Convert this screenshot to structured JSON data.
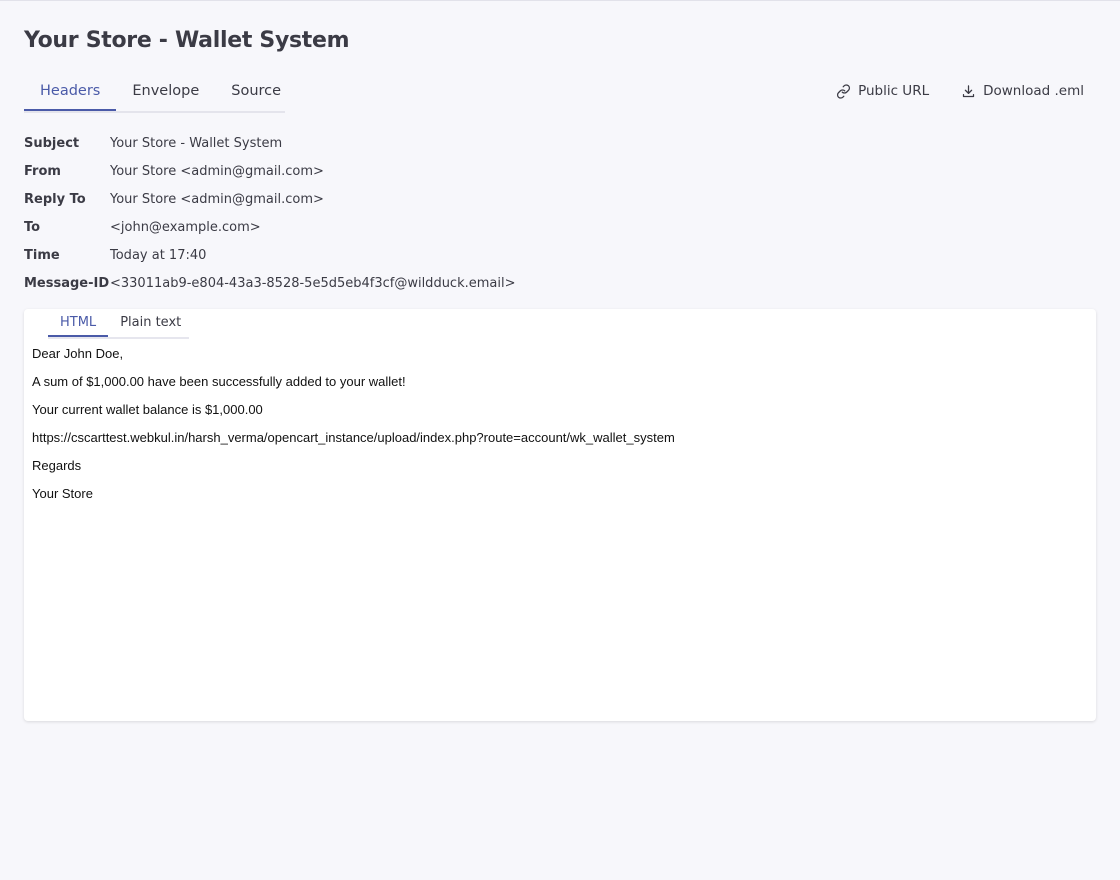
{
  "page_title": "Your Store - Wallet System",
  "tabs": [
    {
      "label": "Headers",
      "active": true
    },
    {
      "label": "Envelope",
      "active": false
    },
    {
      "label": "Source",
      "active": false
    }
  ],
  "actions": {
    "public_url": {
      "label": "Public URL",
      "icon": "link-icon"
    },
    "download": {
      "label": "Download .eml",
      "icon": "download-icon"
    }
  },
  "headers": [
    {
      "label": "Subject",
      "value": "Your Store - Wallet System"
    },
    {
      "label": "From",
      "value": "Your Store <admin@gmail.com>"
    },
    {
      "label": "Reply To",
      "value": "Your Store <admin@gmail.com>"
    },
    {
      "label": "To",
      "value": "<john@example.com>"
    },
    {
      "label": "Time",
      "value": "Today at 17:40"
    },
    {
      "label": "Message-ID",
      "value": "<33011ab9-e804-43a3-8528-5e5d5eb4f3cf@wildduck.email>"
    }
  ],
  "message_tabs": [
    {
      "label": "HTML",
      "active": true
    },
    {
      "label": "Plain text",
      "active": false
    }
  ],
  "message_body": [
    "Dear John Doe,",
    "A sum of $1,000.00 have been successfully added to your wallet!",
    "Your current wallet balance is $1,000.00",
    "https://cscarttest.webkul.in/harsh_verma/opencart_instance/upload/index.php?route=account/wk_wallet_system",
    "Regards",
    "Your Store"
  ],
  "colors": {
    "accent": "#4a5aa8",
    "background": "#f7f7fb",
    "text": "#3b3b45"
  }
}
